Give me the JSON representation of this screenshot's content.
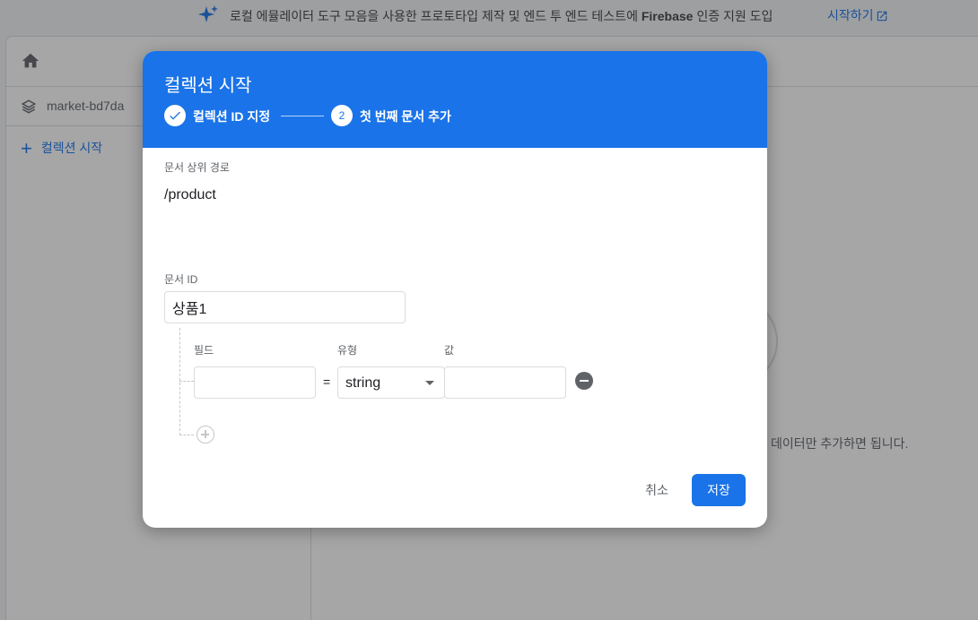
{
  "banner": {
    "icon": "sparkle-icon",
    "text_prefix": "로컬 에뮬레이터 도구 모음을 사용한 프로토타입 제작 및 엔드 투 엔드 테스트에",
    "text_bold": "Firebase",
    "text_suffix": "인증 지원 도입",
    "link_label": "시작하기"
  },
  "background": {
    "project": "market-bd7da",
    "start_collection": "컬렉션 시작",
    "hint": "데이터만 추가하면 됩니다."
  },
  "dialog": {
    "title": "컬렉션 시작",
    "steps": [
      {
        "label": "컬렉션 ID 지정",
        "state": "done"
      },
      {
        "number": "2",
        "label": "첫 번째 문서 추가",
        "state": "active"
      }
    ],
    "parent_path_label": "문서 상위 경로",
    "parent_path_value": "/product",
    "doc_id_label": "문서 ID",
    "doc_id_value": "상품1",
    "field_header": "필드",
    "type_header": "유형",
    "value_header": "값",
    "fields": [
      {
        "name": "",
        "type": "string",
        "value": ""
      }
    ],
    "equals": "=",
    "cancel_label": "취소",
    "save_label": "저장"
  },
  "colors": {
    "accent": "#1a73e8",
    "overlay": "rgba(32,33,36,0.40)"
  }
}
